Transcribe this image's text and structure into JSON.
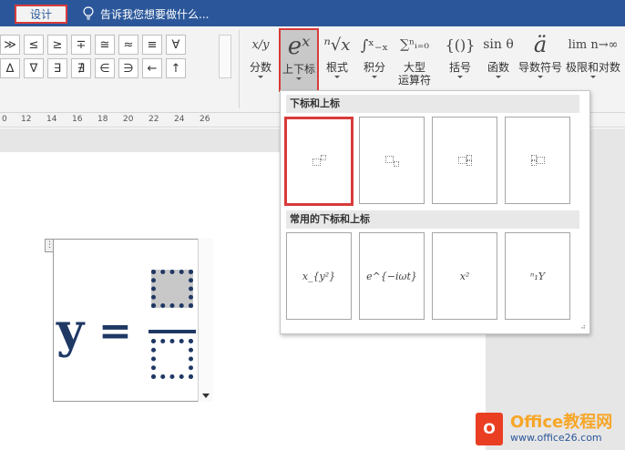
{
  "tabs": {
    "design_label": "设计"
  },
  "tell_me": {
    "placeholder": "告诉我您想要做什么..."
  },
  "symbols": {
    "row1": [
      "≫",
      "≤",
      "≥",
      "∓",
      "≅",
      "≈",
      "≡",
      "∀"
    ],
    "row2": [
      "∆",
      "∇",
      "∃",
      "∄",
      "∈",
      "∋",
      "←",
      "↑"
    ]
  },
  "ribbon": {
    "fraction": {
      "icon": "x/y",
      "label": "分数"
    },
    "script": {
      "icon": "eˣ",
      "label": "上下标"
    },
    "radical": {
      "icon": "ⁿ√x",
      "label": "根式"
    },
    "integral": {
      "icon": "∫ˣ₋ₓ",
      "label": "积分"
    },
    "large_operator": {
      "icon": "∑ⁿᵢ₌₀",
      "label": "大型\n运算符"
    },
    "bracket": {
      "icon": "{()}",
      "label": "括号"
    },
    "function": {
      "icon": "sin θ",
      "label": "函数"
    },
    "accent": {
      "icon": "ä",
      "label": "导数符号"
    },
    "limit": {
      "icon": "lim n→∞",
      "label": "极限和对数"
    }
  },
  "ruler": [
    "0",
    "12",
    "14",
    "16",
    "18",
    "20",
    "22",
    "24",
    "26"
  ],
  "equation": {
    "variable": "y",
    "equals": "="
  },
  "dropdown": {
    "section1_title": "下标和上标",
    "section2_title": "常用的下标和上标",
    "common": [
      "x_{y²}",
      "e^{−iωt}",
      "x²",
      "ⁿ₁Y"
    ]
  },
  "watermark": {
    "title": "Office教程网",
    "url": "www.office26.com"
  },
  "colors": {
    "accent": "#2b579a",
    "highlight": "#d83b3b",
    "equation": "#1f3864"
  }
}
